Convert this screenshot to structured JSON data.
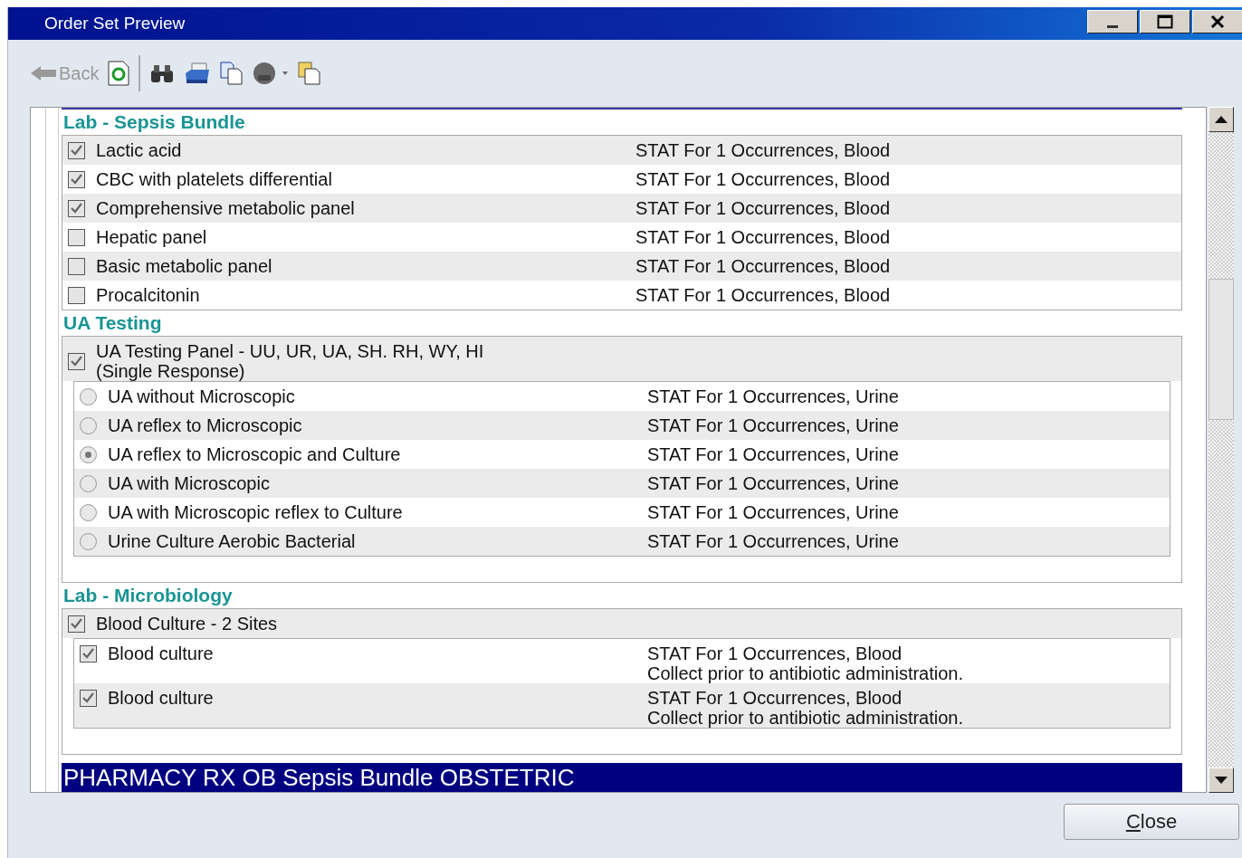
{
  "window": {
    "title": "Order Set Preview"
  },
  "toolbar": {
    "back": {
      "label": "Back",
      "disabled": true
    }
  },
  "sections": [
    {
      "title": "Lab - Sepsis Bundle",
      "items": [
        {
          "kind": "check",
          "label": "Lactic acid",
          "checked": true,
          "detail": "STAT For 1 Occurrences, Blood"
        },
        {
          "kind": "check",
          "label": "CBC with platelets differential",
          "checked": true,
          "detail": "STAT For 1 Occurrences, Blood"
        },
        {
          "kind": "check",
          "label": "Comprehensive metabolic panel",
          "checked": true,
          "detail": "STAT For 1 Occurrences, Blood"
        },
        {
          "kind": "check",
          "label": "Hepatic panel",
          "checked": false,
          "detail": "STAT For 1 Occurrences, Blood"
        },
        {
          "kind": "check",
          "label": "Basic metabolic panel",
          "checked": false,
          "detail": "STAT For 1 Occurrences, Blood"
        },
        {
          "kind": "check",
          "label": "Procalcitonin",
          "checked": false,
          "detail": "STAT For 1 Occurrences, Blood"
        }
      ]
    },
    {
      "title": "UA Testing",
      "items": [
        {
          "kind": "group",
          "label": "UA Testing Panel - UU, UR, UA, SH. RH, WY, HI",
          "sublabel": "(Single Response)",
          "checked": true,
          "children": [
            {
              "kind": "radio",
              "label": "UA without Microscopic",
              "selected": false,
              "detail": "STAT For 1 Occurrences, Urine"
            },
            {
              "kind": "radio",
              "label": "UA reflex to Microscopic",
              "selected": false,
              "detail": "STAT For 1 Occurrences, Urine"
            },
            {
              "kind": "radio",
              "label": "UA reflex to Microscopic and Culture",
              "selected": true,
              "detail": "STAT For 1 Occurrences, Urine"
            },
            {
              "kind": "radio",
              "label": "UA with Microscopic",
              "selected": false,
              "detail": "STAT For 1 Occurrences, Urine"
            },
            {
              "kind": "radio",
              "label": "UA with Microscopic reflex to Culture",
              "selected": false,
              "detail": "STAT For 1 Occurrences, Urine"
            },
            {
              "kind": "radio",
              "label": "Urine Culture Aerobic Bacterial",
              "selected": false,
              "detail": "STAT For 1 Occurrences, Urine"
            }
          ]
        }
      ]
    },
    {
      "title": "Lab - Microbiology",
      "items": [
        {
          "kind": "group",
          "label": "Blood Culture - 2 Sites",
          "checked": true,
          "children": [
            {
              "kind": "check",
              "label": "Blood culture",
              "checked": true,
              "detail": "STAT For 1 Occurrences, Blood",
              "note": "Collect prior to antibiotic administration."
            },
            {
              "kind": "check",
              "label": "Blood culture",
              "checked": true,
              "detail": "STAT For 1 Occurrences, Blood",
              "note": "Collect prior to antibiotic administration."
            }
          ]
        }
      ]
    }
  ],
  "banner": "PHARMACY RX OB Sepsis Bundle OBSTETRIC",
  "close_button": {
    "label": "Close"
  }
}
